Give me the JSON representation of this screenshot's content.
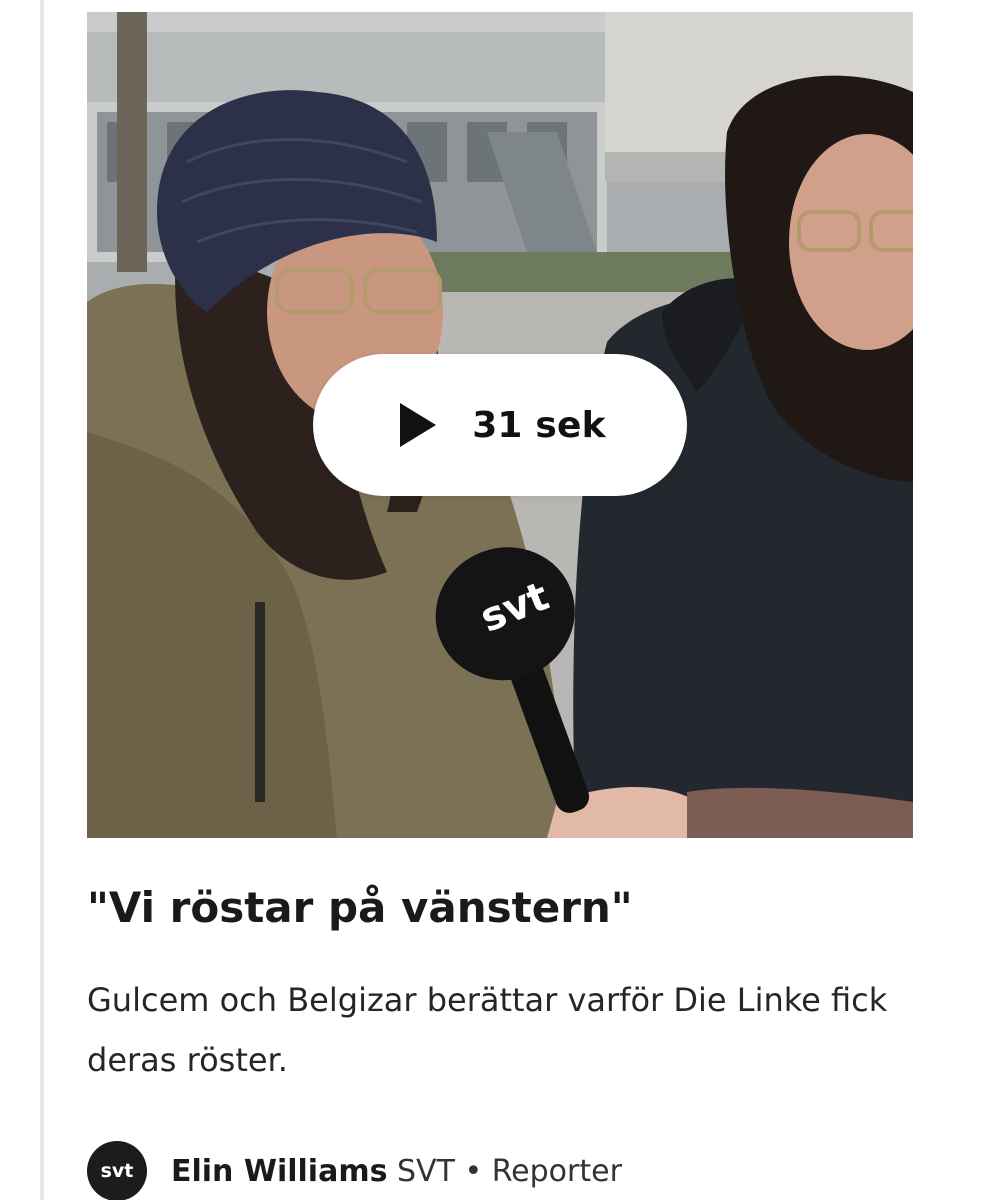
{
  "video": {
    "duration_label": "31 sek",
    "microphone_brand": "svt",
    "play_icon": "play-icon"
  },
  "article": {
    "headline": "\"Vi röstar på vänstern\"",
    "summary": "Gulcem och Belgizar berättar varför Die Linke fick deras röster."
  },
  "byline": {
    "avatar_text": "svt",
    "author_name": "Elin Williams",
    "organization": "SVT",
    "separator": "•",
    "role": "Reporter"
  }
}
